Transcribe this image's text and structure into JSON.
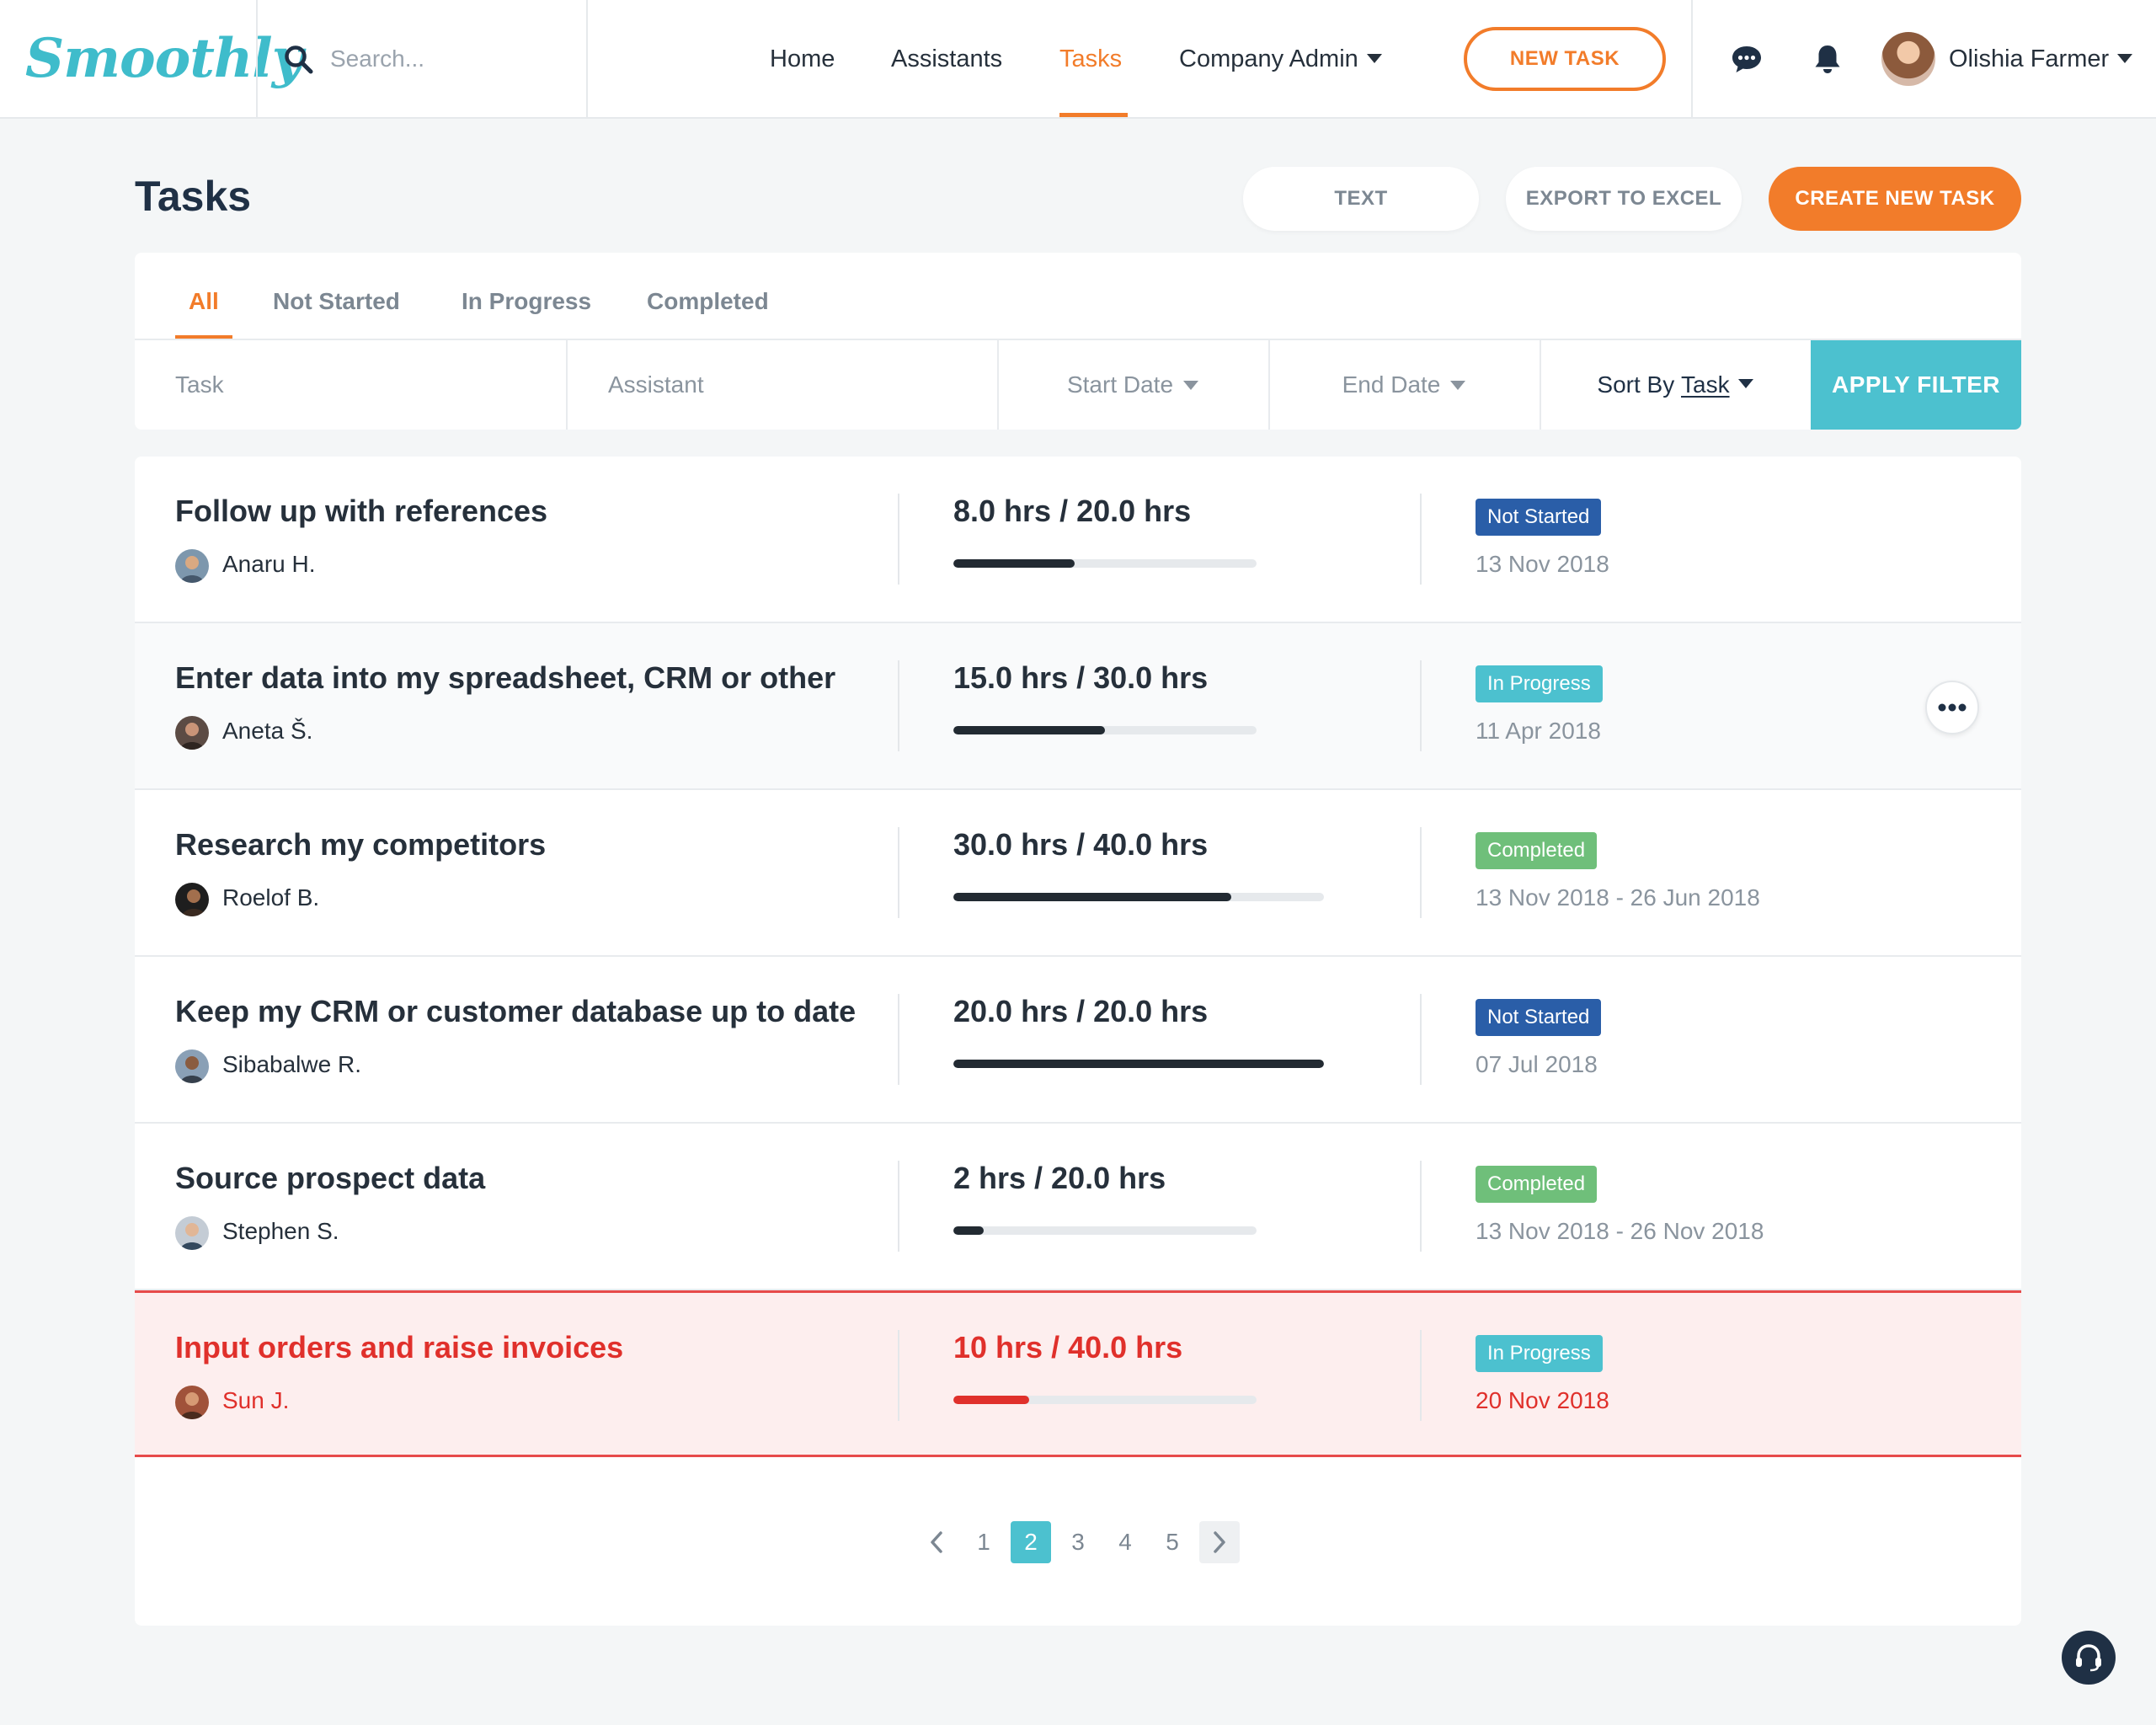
{
  "app": {
    "logo": "Smoothly"
  },
  "search": {
    "placeholder": "Search..."
  },
  "nav": {
    "home": "Home",
    "assistants": "Assistants",
    "tasks": "Tasks",
    "company_admin": "Company Admin",
    "new_task": "NEW TASK"
  },
  "user": {
    "name": "Olishia Farmer"
  },
  "page": {
    "title": "Tasks",
    "text_btn": "TEXT",
    "export_btn": "EXPORT TO EXCEL",
    "create_btn": "CREATE NEW TASK"
  },
  "tabs": [
    "All",
    "Not Started",
    "In Progress",
    "Completed"
  ],
  "filters": {
    "task_placeholder": "Task",
    "assistant_placeholder": "Assistant",
    "start_date": "Start Date",
    "end_date": "End Date",
    "sort_by": "Sort By",
    "sort_field": "Task",
    "apply": "APPLY FILTER"
  },
  "status_colors": {
    "Not Started": "#2a5ea8",
    "In Progress": "#4cc1cf",
    "Completed": "#6fbf7a"
  },
  "tasks": [
    {
      "title": "Follow up with references",
      "assignee": "Anaru H.",
      "hours": "8.0 hrs / 20.0 hrs",
      "progress": 0.4,
      "status": "Not Started",
      "date": "13 Nov 2018"
    },
    {
      "title": "Enter data into my spreadsheet, CRM or other",
      "assignee": "Aneta Š.",
      "hours": "15.0 hrs / 30.0 hrs",
      "progress": 0.5,
      "status": "In Progress",
      "date": "11 Apr 2018"
    },
    {
      "title": "Research my competitors",
      "assignee": "Roelof B.",
      "hours": "30.0 hrs / 40.0 hrs",
      "progress": 0.75,
      "status": "Completed",
      "date": "13 Nov 2018 - 26 Jun 2018"
    },
    {
      "title": "Keep my CRM or customer database up to date",
      "assignee": "Sibabalwe R.",
      "hours": "20.0 hrs / 20.0 hrs",
      "progress": 1.0,
      "status": "Not Started",
      "date": "07 Jul 2018"
    },
    {
      "title": "Source prospect data",
      "assignee": "Stephen S.",
      "hours": "2 hrs / 20.0 hrs",
      "progress": 0.1,
      "status": "Completed",
      "date": "13 Nov 2018 - 26 Nov 2018"
    },
    {
      "title": "Input orders and raise invoices",
      "assignee": "Sun J.",
      "hours": "10 hrs / 40.0 hrs",
      "progress": 0.25,
      "status": "In Progress",
      "date": "20 Nov 2018"
    }
  ],
  "pagination": {
    "pages": [
      "1",
      "2",
      "3",
      "4",
      "5"
    ],
    "current": "2"
  }
}
